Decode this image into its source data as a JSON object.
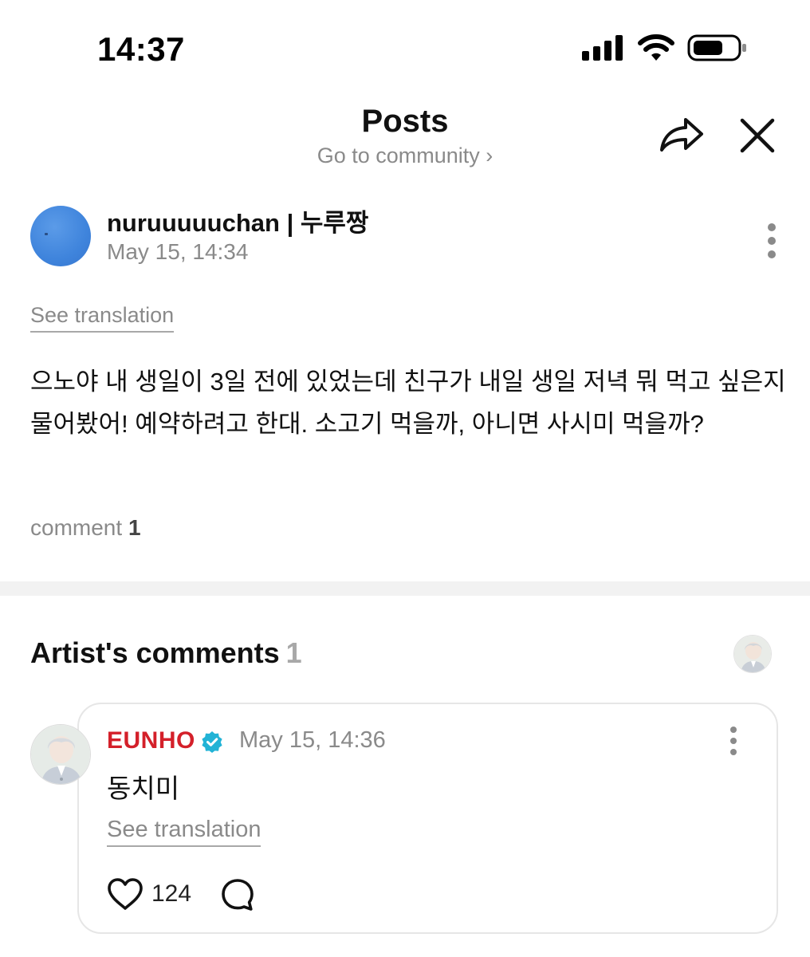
{
  "status_bar": {
    "time": "14:37",
    "icons": [
      "cellular-signal-icon",
      "wifi-icon",
      "battery-icon"
    ]
  },
  "header": {
    "title": "Posts",
    "subtitle": "Go to community ›",
    "share_icon": "share-icon",
    "close_icon": "close-icon"
  },
  "post": {
    "author": "nuruuuuuchan | 누루짱",
    "date": "May 15, 14:34",
    "see_translation": "See translation",
    "body": "으노야 내 생일이 3일 전에 있었는데 친구가 내일 생일 저녁 뭐 먹고 싶은지 물어봤어! 예약하려고 한대. 소고기 먹을까, 아니면 사시미 먹을까?",
    "comment_label": "comment",
    "comment_count": "1"
  },
  "artist_comments": {
    "title": "Artist's comments",
    "count": "1",
    "comment": {
      "author": "EUNHO",
      "date": "May 15, 14:36",
      "text": "동치미",
      "see_translation": "See translation",
      "like_count": "124"
    }
  },
  "colors": {
    "artist_name": "#d4202a",
    "verified_badge": "#22b3d6",
    "muted_text": "#8a8a8a",
    "divider": "#f2f2f2"
  }
}
